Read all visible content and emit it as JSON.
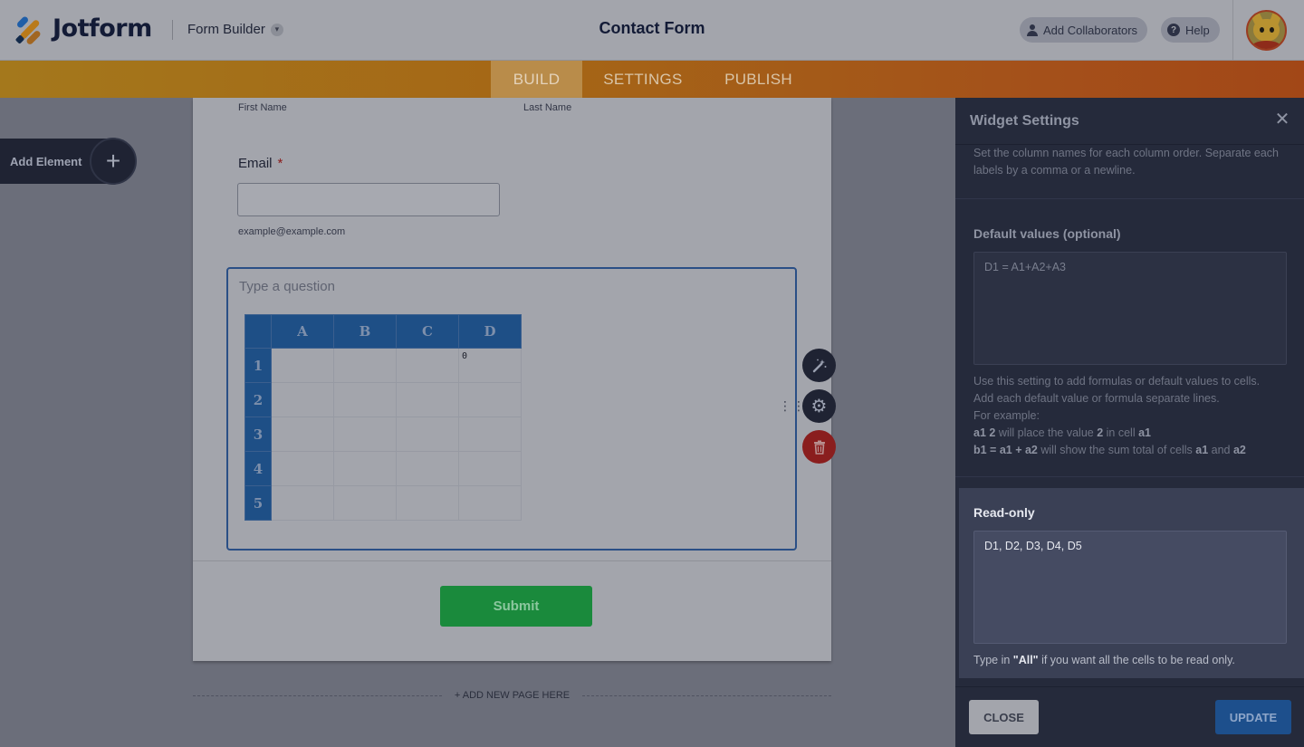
{
  "header": {
    "logo_text": "Jotform",
    "builder_label": "Form Builder",
    "form_title": "Contact Form",
    "collaborators_label": "Add Collaborators",
    "help_label": "Help"
  },
  "nav": {
    "tabs": [
      {
        "label": "BUILD",
        "active": true
      },
      {
        "label": "SETTINGS",
        "active": false
      },
      {
        "label": "PUBLISH",
        "active": false
      }
    ]
  },
  "sidebar": {
    "add_element_label": "Add Element"
  },
  "form": {
    "first_name_label": "First Name",
    "last_name_label": "Last Name",
    "email_label": "Email",
    "email_required_mark": "*",
    "email_value": "",
    "email_hint": "example@example.com",
    "question_placeholder": "Type a question",
    "spreadsheet": {
      "columns": [
        "A",
        "B",
        "C",
        "D"
      ],
      "rows": [
        "1",
        "2",
        "3",
        "4",
        "5"
      ],
      "cells": [
        [
          "",
          "",
          "",
          "0"
        ],
        [
          "",
          "",
          "",
          ""
        ],
        [
          "",
          "",
          "",
          ""
        ],
        [
          "",
          "",
          "",
          ""
        ],
        [
          "",
          "",
          "",
          ""
        ]
      ]
    },
    "submit_label": "Submit",
    "add_page_label": "+ ADD NEW PAGE HERE"
  },
  "panel": {
    "title": "Widget Settings",
    "column_names_desc": "Set the column names for each column order. Separate each labels by a comma or a newline.",
    "default_values_label": "Default values (optional)",
    "default_values_value": "D1 = A1+A2+A3",
    "default_help_1": "Use this setting to add formulas or default values to cells.",
    "default_help_2": "Add each default value or formula separate lines.",
    "default_help_3": "For example:",
    "example1_code": "a1 2",
    "example1_mid": " will place the value ",
    "example1_value": "2",
    "example1_end": " in cell ",
    "example1_cell": "a1",
    "example2_code": "b1 = a1 + a2",
    "example2_mid": " will show the sum total of cells ",
    "example2_cell1": "a1",
    "example2_and": " and ",
    "example2_cell2": "a2",
    "readonly_label": "Read-only",
    "readonly_value": "D1, D2, D3, D4, D5",
    "readonly_help_pre": "Type in ",
    "readonly_help_all": "\"All\"",
    "readonly_help_post": " if you want all the cells to be read only.",
    "close_label": "CLOSE",
    "update_label": "UPDATE"
  },
  "icons": {
    "wand": "magic-wand-icon",
    "gear": "gear-icon",
    "trash": "trash-icon",
    "close": "close-icon",
    "plus": "plus-icon",
    "chevron": "chevron-down-icon"
  }
}
